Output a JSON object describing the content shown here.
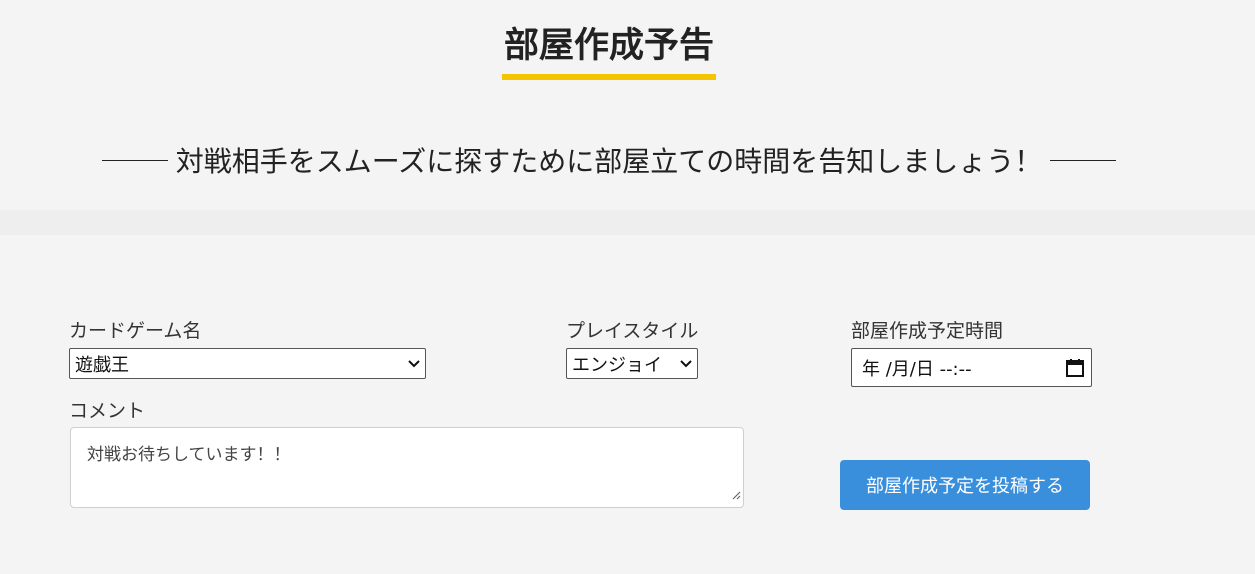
{
  "header": {
    "title": "部屋作成予告",
    "subtitle": "対戦相手をスムーズに探すために部屋立ての時間を告知しましょう！"
  },
  "form": {
    "card_game": {
      "label": "カードゲーム名",
      "value": "遊戯王"
    },
    "play_style": {
      "label": "プレイスタイル",
      "value": "エンジョイ"
    },
    "schedule": {
      "label": "部屋作成予定時間",
      "value": "年 /月/日  --:--"
    },
    "comment": {
      "label": "コメント",
      "placeholder": "対戦お待ちしています！！"
    },
    "submit_label": "部屋作成予定を投稿する"
  },
  "colors": {
    "accent_underline": "#f5c400",
    "button": "#3a8fdc",
    "background": "#f4f4f4"
  },
  "icons": [
    "chevron-down-icon",
    "calendar-icon",
    "resize-grip-icon"
  ]
}
